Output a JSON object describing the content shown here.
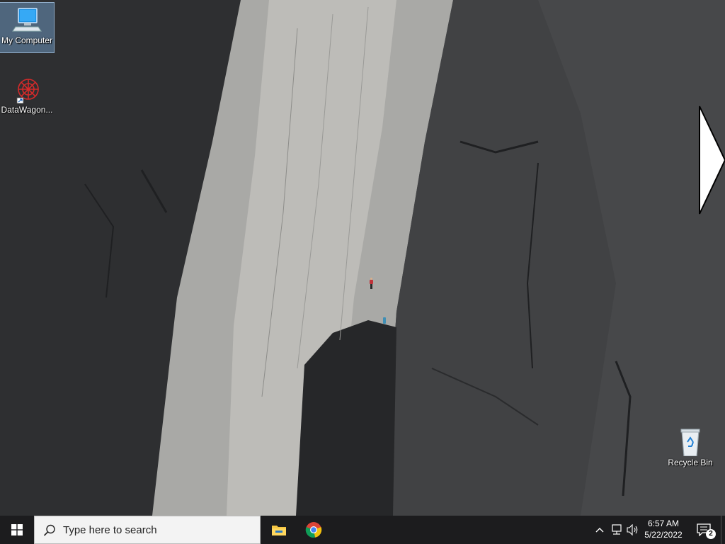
{
  "desktop": {
    "icons": [
      {
        "label": "My Computer",
        "icon": "computer-icon",
        "selected": true
      },
      {
        "label": "DataWagon...",
        "icon": "datawagon-icon",
        "selected": false
      },
      {
        "label": "Recycle Bin",
        "icon": "recycle-bin-icon",
        "selected": false
      }
    ],
    "wallpaper": "rock-climbing-cliff"
  },
  "taskbar": {
    "start_icon": "windows-logo-icon",
    "search": {
      "placeholder": "Type here to search"
    },
    "pinned": [
      {
        "name": "File Explorer",
        "icon": "file-explorer-icon"
      },
      {
        "name": "Google Chrome",
        "icon": "chrome-icon"
      }
    ],
    "tray": {
      "icons": [
        "chevron-up-icon",
        "network-icon",
        "volume-icon"
      ],
      "time": "6:57 AM",
      "date": "5/22/2022",
      "notification_count": "2"
    }
  },
  "colors": {
    "taskbar_bg": "#1c1c1e",
    "selection": "#78aadc",
    "accent": "#76b9ed"
  }
}
